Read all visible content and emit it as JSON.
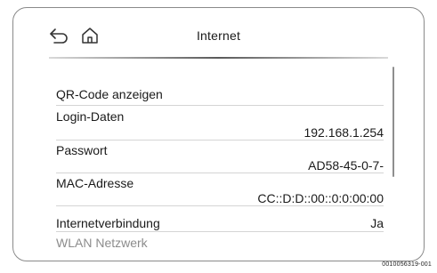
{
  "header": {
    "title": "Internet",
    "back_icon": "back-arrow-icon",
    "home_icon": "home-icon"
  },
  "list": {
    "items": [
      {
        "label": "QR-Code anzeigen",
        "value": ""
      },
      {
        "label": "Login-Daten",
        "value": "192.168.1.254"
      },
      {
        "label": "Passwort",
        "value": "AD58-45-0-7-"
      },
      {
        "label": "MAC-Adresse",
        "value": "CC::D:D::00::0:0:00:00"
      },
      {
        "label": "Internetverbindung",
        "value": "Ja"
      },
      {
        "label": "WLAN Netzwerk",
        "value": ""
      }
    ]
  },
  "figure_id": "0010056319-001",
  "colors": {
    "frame_border": "#8a8a8a",
    "divider": "#d4d4d4",
    "text": "#1a1a1a",
    "faded_text": "#8c8c8c"
  }
}
